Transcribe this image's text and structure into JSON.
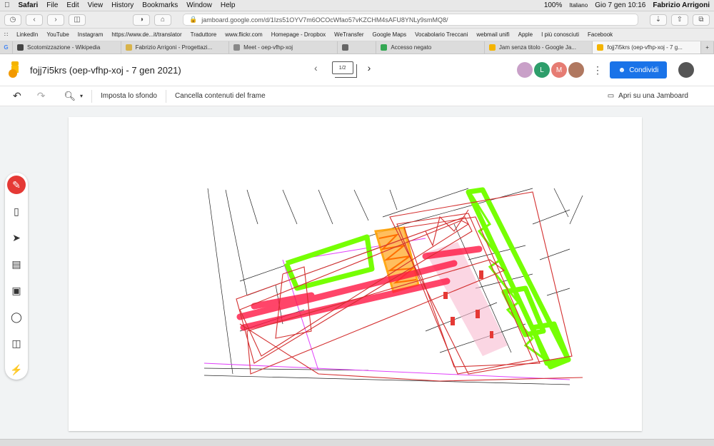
{
  "macmenu": {
    "app": "Safari",
    "items": [
      "File",
      "Edit",
      "View",
      "History",
      "Bookmarks",
      "Window",
      "Help"
    ],
    "battery": "100%",
    "language": "Italiano",
    "datetime": "Gio 7 gen  10:16",
    "user": "Fabrizio Arrigoni"
  },
  "browser": {
    "url": "jamboard.google.com/d/1Izs51OYV7m6OCOcWfao57vKZCHM4sAFU8YNLy9smMQ8/"
  },
  "bookmarks": [
    "LinkedIn",
    "YouTube",
    "Instagram",
    "https://www.de...it/translator",
    "Traduttore",
    "www.flickr.com",
    "Homepage - Dropbox",
    "WeTransfer",
    "Google Maps",
    "Vocabolario Treccani",
    "webmail unifi",
    "Apple",
    "I più conosciuti",
    "Facebook"
  ],
  "tabs": [
    {
      "label": "Scotomizzazione - Wikipedia",
      "color": "#444444"
    },
    {
      "label": "Fabrizio Arrigoni - Progettazi...",
      "color": "#d8b34a"
    },
    {
      "label": "Meet - oep-vfhp-xoj",
      "color": "#888888"
    },
    {
      "label": "",
      "color": "#666666"
    },
    {
      "label": "Accesso negato",
      "color": "#34a853"
    },
    {
      "label": "Jam senza titolo - Google Ja...",
      "color": "#f4b400"
    },
    {
      "label": "fojj7i5krs (oep-vfhp-xoj - 7 g...",
      "color": "#f4b400"
    }
  ],
  "app": {
    "title": "fojj7i5krs (oep-vfhp-xoj - 7 gen 2021)",
    "frame_counter": "1/2",
    "avatars": [
      {
        "initial": "",
        "color": "#c9a0c8"
      },
      {
        "initial": "L",
        "color": "#2e9e6b"
      },
      {
        "initial": "M",
        "color": "#e67c73"
      },
      {
        "initial": "",
        "color": "#b07860"
      }
    ],
    "share_label": "Condividi",
    "brand_color": "#1a73e8"
  },
  "actions": {
    "set_background": "Imposta lo sfondo",
    "clear_frame": "Cancella contenuti del frame",
    "open_jamboard": "Apri su una Jamboard"
  },
  "tools": [
    "pen-icon",
    "eraser-icon",
    "select-icon",
    "sticky-note-icon",
    "image-icon",
    "shape-icon",
    "textbox-icon",
    "laser-icon"
  ]
}
